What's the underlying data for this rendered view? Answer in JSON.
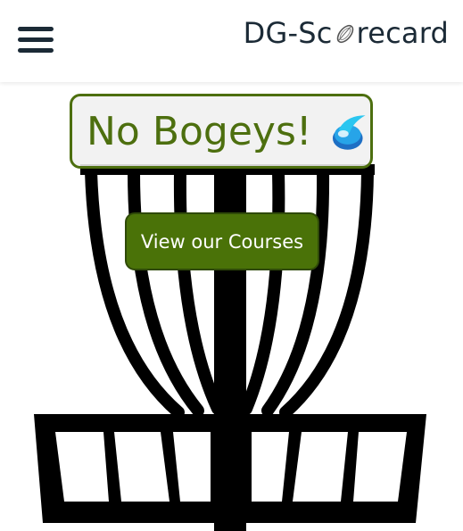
{
  "navbar": {
    "menu_icon": "hamburger-menu-icon",
    "brand_prefix": "DG-Sc",
    "brand_logo_icon": "disc-logo-icon",
    "brand_suffix": "recard"
  },
  "hero": {
    "title": "No Bogeys!",
    "title_icon": "disc-swoosh-icon",
    "cta_label": "View our Courses",
    "background_icon": "disc-golf-basket-icon"
  },
  "colors": {
    "brand_text": "#1b2a36",
    "accent_green": "#4d6f0f",
    "button_green": "#4a7208",
    "button_text": "#ffffff"
  }
}
